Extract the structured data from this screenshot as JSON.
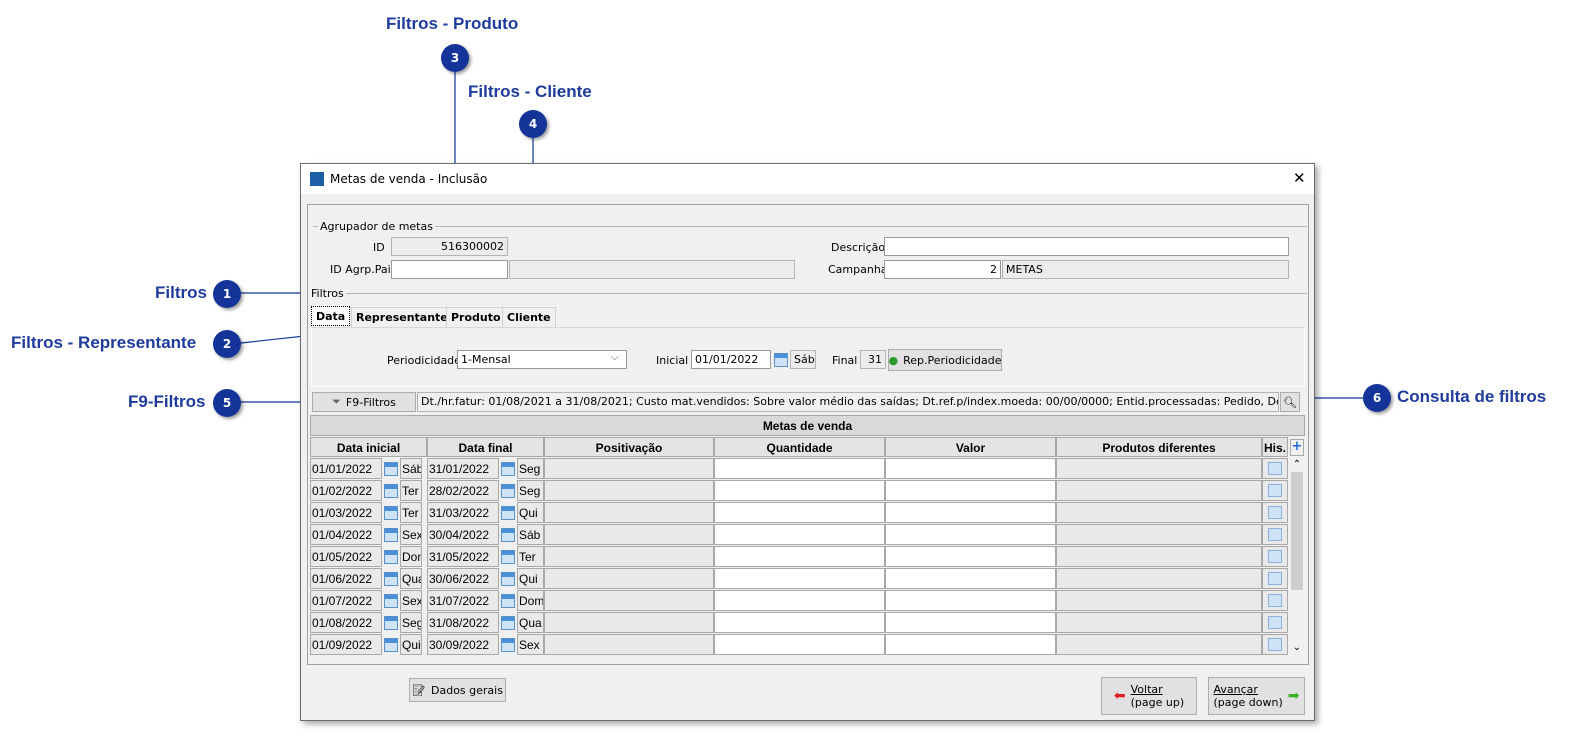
{
  "window": {
    "title": "Metas de venda - Inclusão",
    "close": "✕"
  },
  "agrupador": {
    "legend": "Agrupador de metas",
    "id_label": "ID",
    "id_value": "516300002",
    "pai_label": "ID Agrp.Pai",
    "pai_value": "",
    "pai_desc": "",
    "descricao_label": "Descrição",
    "descricao_value": "",
    "campanha_label": "Campanha",
    "campanha_value": "2",
    "campanha_desc": "METAS"
  },
  "filtros": {
    "legend": "Filtros",
    "tabs": [
      "Data",
      "Representante",
      "Produto",
      "Cliente"
    ],
    "active_tab": "Data",
    "periodicidade_label": "Periodicidade",
    "periodicidade_value": "1-Mensal",
    "inicial_label": "Inicial",
    "inicial_value": "01/01/2022",
    "inicial_day": "Sáb",
    "final_label": "Final",
    "final_value": "31",
    "rep_button": "Rep.Periodicidade",
    "f9_button": "F9-Filtros",
    "summary": "Dt./hr.fatur: 01/08/2021 a 31/08/2021; Custo mat.vendidos: Sobre valor médio das saídas; Dt.ref.p/index.moeda: 00/00/0000; Entid.processadas: Pedido, Devolução,"
  },
  "grid": {
    "title": "Metas de venda",
    "columns": [
      "Data inicial",
      "Data final",
      "Positivação",
      "Quantidade",
      "Valor",
      "Produtos diferentes",
      "His."
    ],
    "rows": [
      [
        "01/01/2022",
        "Sáb",
        "31/01/2022",
        "Seg"
      ],
      [
        "01/02/2022",
        "Ter",
        "28/02/2022",
        "Seg"
      ],
      [
        "01/03/2022",
        "Ter",
        "31/03/2022",
        "Qui"
      ],
      [
        "01/04/2022",
        "Sex",
        "30/04/2022",
        "Sáb"
      ],
      [
        "01/05/2022",
        "Dom",
        "31/05/2022",
        "Ter"
      ],
      [
        "01/06/2022",
        "Qua",
        "30/06/2022",
        "Qui"
      ],
      [
        "01/07/2022",
        "Sex",
        "31/07/2022",
        "Dom"
      ],
      [
        "01/08/2022",
        "Seg",
        "31/08/2022",
        "Qua"
      ],
      [
        "01/09/2022",
        "Qui",
        "30/09/2022",
        "Sex"
      ]
    ]
  },
  "footer": {
    "dados_gerais": "Dados gerais",
    "voltar": "Voltar",
    "voltar_sub": "(page up)",
    "avancar": "Avançar",
    "avancar_sub": "(page down)"
  },
  "annotations": [
    {
      "n": "1",
      "label": "Filtros"
    },
    {
      "n": "2",
      "label": "Filtros - Representante"
    },
    {
      "n": "3",
      "label": "Filtros - Produto"
    },
    {
      "n": "4",
      "label": "Filtros - Cliente"
    },
    {
      "n": "5",
      "label": "F9-Filtros"
    },
    {
      "n": "6",
      "label": "Consulta de filtros"
    }
  ],
  "colors": {
    "annotation": "#1f3c9c",
    "badge": "#14349a"
  }
}
